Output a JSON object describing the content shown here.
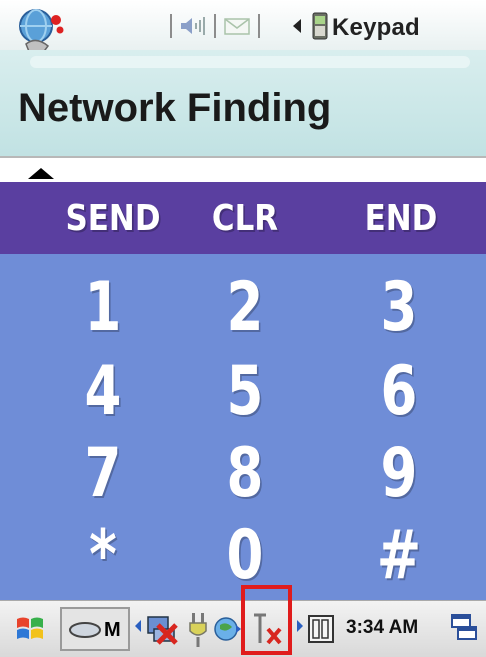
{
  "status_bar": {
    "keypad_label": "Keypad"
  },
  "header": {
    "title": "Network Finding"
  },
  "keypad": {
    "function_keys": [
      "SEND",
      "CLR",
      "END"
    ],
    "rows": [
      [
        "1",
        "2",
        "3"
      ],
      [
        "4",
        "5",
        "6"
      ],
      [
        "7",
        "8",
        "9"
      ],
      [
        "*",
        "0",
        "#"
      ]
    ]
  },
  "taskbar": {
    "input_label": "M",
    "clock": "3:34 AM"
  },
  "colors": {
    "keypad_top": "#5a3fa0",
    "keypad_body": "#6f8dd7",
    "highlight": "#e01c1c"
  }
}
